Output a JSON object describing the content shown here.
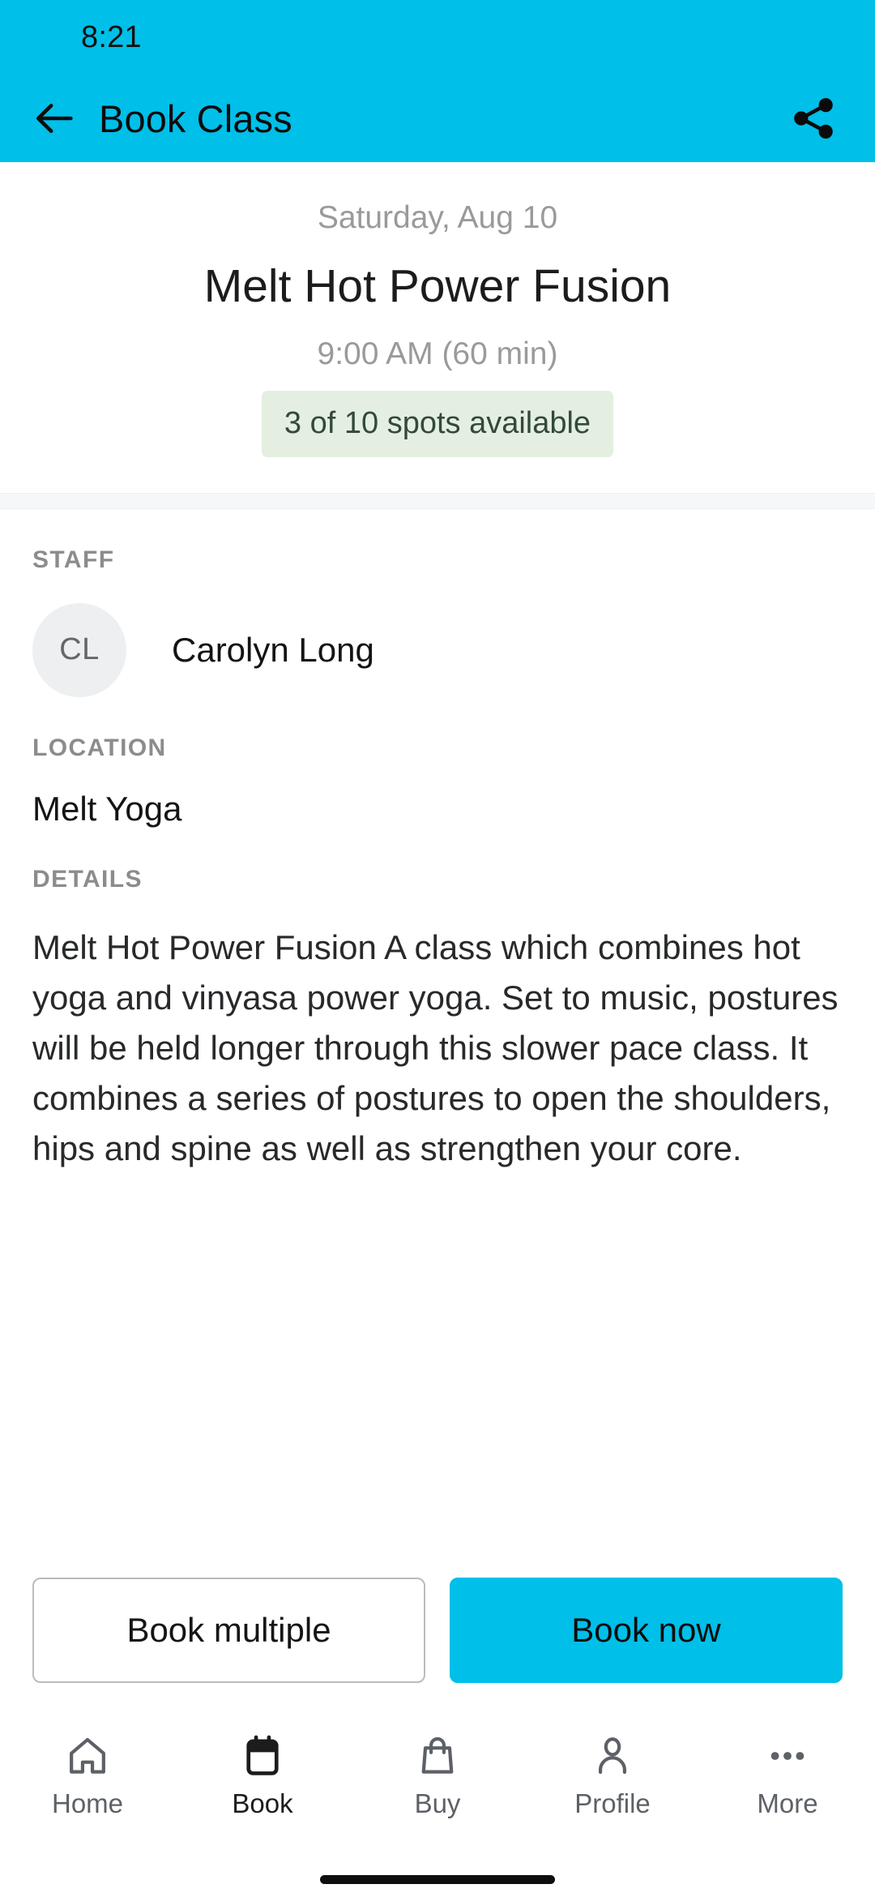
{
  "status_bar": {
    "time": "8:21"
  },
  "app_bar": {
    "title": "Book Class",
    "back_icon": "back-arrow-icon",
    "share_icon": "share-icon"
  },
  "hero": {
    "date": "Saturday, Aug 10",
    "class_name": "Melt Hot Power Fusion",
    "time_duration": "9:00 AM (60 min)",
    "spots_badge": "3 of 10 spots available"
  },
  "sections": {
    "staff_label": "STAFF",
    "staff_initials": "CL",
    "staff_name": "Carolyn Long",
    "location_label": "LOCATION",
    "location_value": "Melt Yoga",
    "details_label": "DETAILS",
    "details_text": "Melt Hot Power Fusion A class which combines hot yoga and vinyasa power yoga. Set to music, postures will be held longer through this slower pace class. It combines a series of postures to open the shoulders, hips and spine as well as strengthen your core."
  },
  "actions": {
    "book_multiple": "Book multiple",
    "book_now": "Book now"
  },
  "bottom_nav": {
    "items": [
      {
        "label": "Home",
        "icon": "home-icon",
        "active": false
      },
      {
        "label": "Book",
        "icon": "calendar-icon",
        "active": true
      },
      {
        "label": "Buy",
        "icon": "bag-icon",
        "active": false
      },
      {
        "label": "Profile",
        "icon": "person-icon",
        "active": false
      },
      {
        "label": "More",
        "icon": "ellipsis-icon",
        "active": false
      }
    ]
  },
  "colors": {
    "accent": "#00bfe8",
    "badge_bg": "#e4efe2",
    "badge_text": "#33493a",
    "muted_text": "#9a9a9a"
  }
}
